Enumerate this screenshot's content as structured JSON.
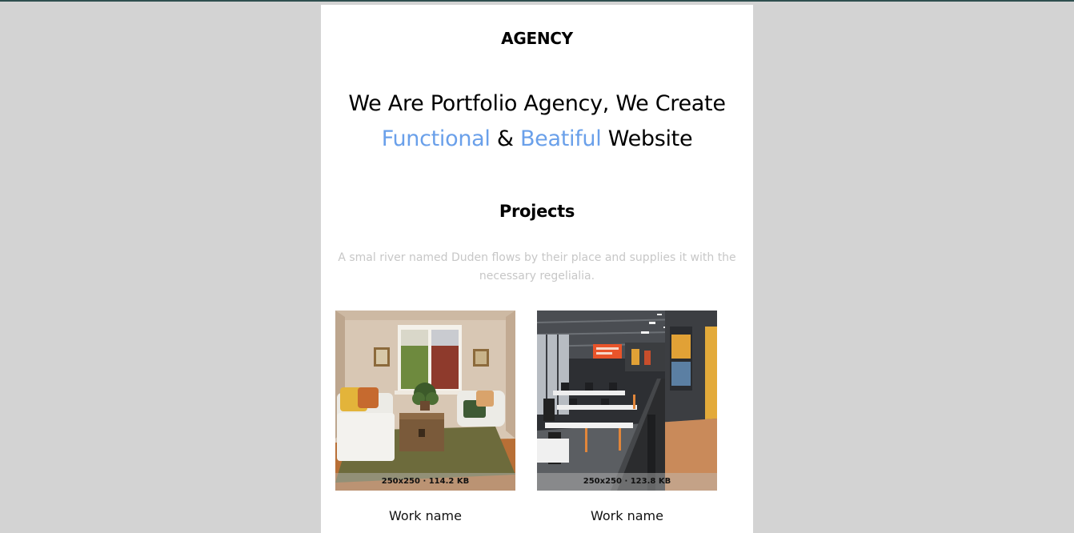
{
  "header": {
    "brand": "AGENCY"
  },
  "hero": {
    "line1": "We Are Portfolio Agency, We Create",
    "word_functional": "Functional",
    "amp": "&",
    "word_beautiful": "Beatiful",
    "word_website": "Website",
    "accent_color": "#6aa0ea"
  },
  "projects": {
    "title": "Projects",
    "description": "A smal river named Duden flows by their place and supplies it with the necessary regelialia.",
    "items": [
      {
        "image_caption": "250x250 · 114.2 KB",
        "name": "Work name",
        "image_subject": "living-room-photo"
      },
      {
        "image_caption": "250x250 · 123.8 KB",
        "name": "Work name",
        "image_subject": "office-interior-photo"
      }
    ]
  },
  "colors": {
    "page_background": "#d3d3d3",
    "card_background": "#ffffff",
    "muted_text": "#c7c7c7"
  }
}
